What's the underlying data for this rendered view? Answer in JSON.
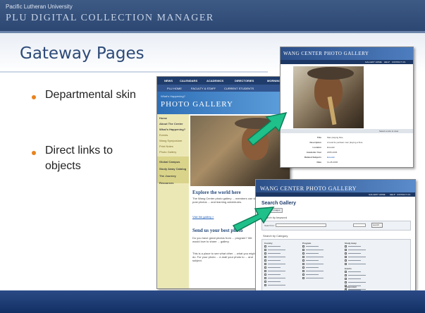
{
  "header": {
    "institution": "Pacific Lutheran University",
    "app_title": "PLU DIGITAL COLLECTION MANAGER"
  },
  "slide": {
    "title": "Gateway Pages",
    "bullets": [
      "Departmental skin",
      "Direct links to objects"
    ]
  },
  "main_page": {
    "top_nav": [
      "NEWS",
      "CALENDARS",
      "ACADEMICS",
      "DIRECTORIES",
      "MORNING"
    ],
    "sub_nav": [
      "PLU HOME",
      "FACULTY & STAFF",
      "CURRENT STUDENTS"
    ],
    "banner_small": "What's Happening?",
    "banner_title": "PHOTO GALLERY",
    "sidebar": [
      "Home",
      "About The Center",
      "What's Happening?",
      "Events",
      "Wang Symposium",
      "Print Notes",
      "Photo Gallery",
      "Global Campus",
      "Study Away Catalog",
      "The Journey",
      "Resources"
    ],
    "heading1": "Explore the world here",
    "body1": "The Wang Center photo gallery ... members can view and post photos ... and learning adventures.",
    "link1": "Visit the gallery »",
    "heading2": "Send us your best photo",
    "body2": "Do you have great photos from ... program? We would love to share ... gallery.",
    "body3": "This is a place to see what other ... what you might do. For your photo ... e-mail your photo to ... and subject."
  },
  "object_page": {
    "title": "WANG CENTER PHOTO GALLERY",
    "nav": [
      "GALLERY HOME",
      "HELP",
      "CONTACT US"
    ],
    "caption": "Select a size to view",
    "fields": [
      {
        "label": "Title",
        "value": "Man playing flute"
      },
      {
        "label": "Description",
        "value": "A local tlu partisan man playing a flute"
      },
      {
        "label": "Location",
        "value": "Ecuador"
      },
      {
        "label": "Academic Year",
        "value": "2005-2006"
      },
      {
        "label": "Related Subjects",
        "value": "Ecuador"
      },
      {
        "label": "Date",
        "value": "11-28-2006"
      }
    ]
  },
  "search_page": {
    "title": "WANG CENTER PHOTO GALLERY",
    "nav": [
      "GALLERY HOME",
      "HELP",
      "CONTACT US"
    ],
    "heading": "Search Gallery",
    "tab": "Browse all images",
    "keyword_label": "Search by keyword",
    "search_for": "Search for:",
    "search_button": "search",
    "category_label": "Search by Category",
    "columns": [
      "Country",
      "Program",
      "Study Away",
      "Events",
      "Symposium"
    ],
    "buttons": [
      "search",
      "reset"
    ]
  },
  "colors": {
    "header": "#2c4772",
    "title": "#2d4a78",
    "bullet": "#e8831e",
    "arrow": "#1fc08a",
    "page_banner": "#3b7fc4",
    "sidebar": "#e8e3a4"
  }
}
